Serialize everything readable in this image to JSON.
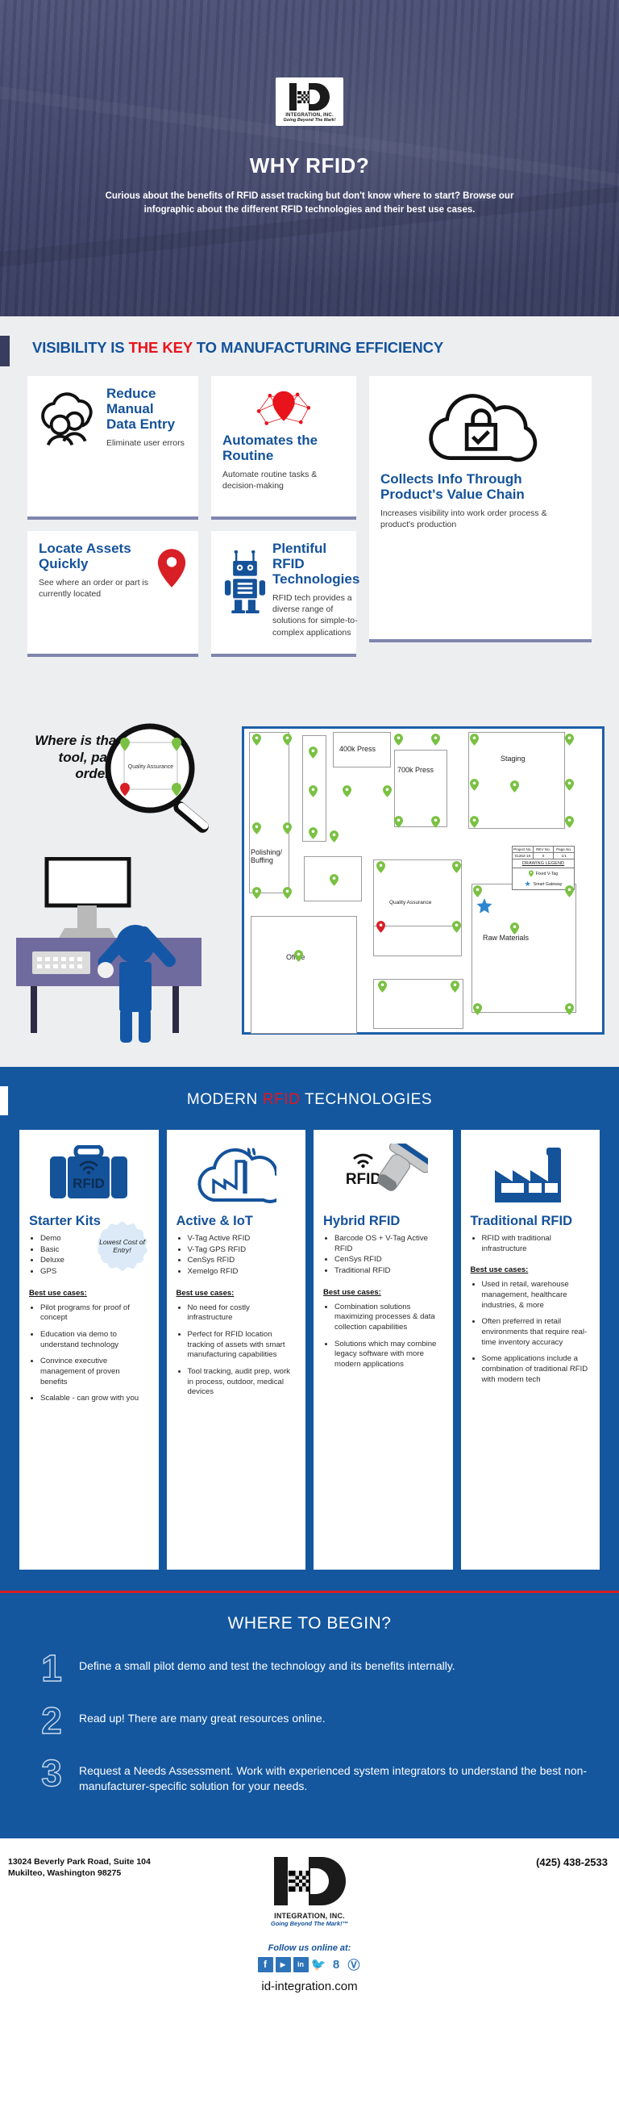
{
  "hero": {
    "logo": {
      "sub": "INTEGRATION, INC.",
      "tagline": "Going Beyond The Mark!"
    },
    "title": "WHY RFID?",
    "subtitle": "Curious about the benefits of RFID asset tracking but don't know where to start? Browse our infographic about the different RFID technologies and their best use cases."
  },
  "section_visibility": {
    "heading_part1": "VISIBILITY IS ",
    "heading_red": "THE KEY",
    "heading_part2": " TO MANUFACTURING EFFICIENCY",
    "cards": [
      {
        "icon": "people-icon",
        "title": "Reduce Manual Data Entry",
        "desc": "Eliminate user errors"
      },
      {
        "icon": "network-node-icon",
        "title": "Automates the Routine",
        "desc": "Automate routine tasks & decision-making"
      },
      {
        "icon": "cloud-lock-icon",
        "title": "Collects Info Through Product's Value Chain",
        "desc": "Increases visibility into work order process & product's production"
      },
      {
        "icon": "map-pin-icon",
        "title": "Locate Assets Quickly",
        "desc": "See where an order or part is currently located"
      },
      {
        "icon": "robot-icon",
        "title": "Plentiful RFID Technologies",
        "desc": "RFID tech provides a diverse range of solutions for simple-to-complex applications"
      }
    ]
  },
  "map_block": {
    "where_text": "Where is that tool, part, order...",
    "magnifier_label": "Quality Assurance",
    "rooms": [
      {
        "label": "400k Press"
      },
      {
        "label": "700k Press"
      },
      {
        "label": "Staging"
      },
      {
        "label": "Polishing/ Buffing"
      },
      {
        "label": "Quality Assurance"
      },
      {
        "label": "Office"
      },
      {
        "label": "Raw Materials"
      }
    ],
    "legend": {
      "headers": [
        "Project No.",
        "REV No.",
        "Page No."
      ],
      "values": [
        "01262-18",
        "0",
        "1/1"
      ],
      "title": "DRAWING LEGEND",
      "keys": [
        {
          "symbol": "pin",
          "label": "Fixed V-Tag"
        },
        {
          "symbol": "star",
          "label": "Smart Gateway"
        }
      ]
    }
  },
  "section_tech": {
    "heading_part1": "MODERN ",
    "heading_red": "RFID",
    "heading_part2": " TECHNOLOGIES",
    "use_cases_label": "Best use cases:",
    "columns": [
      {
        "icon": "rfid-briefcase-icon",
        "icon_text": "RFID",
        "title": "Starter Kits",
        "items": [
          "Demo",
          "Basic",
          "Deluxe",
          "GPS"
        ],
        "badge": "Lowest Cost of Entry!",
        "uses": [
          "Pilot programs for proof of concept",
          "Education via demo to understand technology",
          "Convince executive management of proven benefits",
          "Scalable - can grow with you"
        ]
      },
      {
        "icon": "cloud-factory-icon",
        "title": "Active & IoT",
        "items": [
          "V-Tag Active RFID",
          "V-Tag GPS RFID",
          "CenSys RFID",
          "Xemelgo RFID"
        ],
        "badge": "",
        "uses": [
          "No need for costly infrastructure",
          "Perfect for RFID location tracking of assets with smart manufacturing capabilities",
          "Tool tracking, audit prep, work in process, outdoor, medical devices"
        ]
      },
      {
        "icon": "rfid-scanner-icon",
        "icon_text": "RFID",
        "title": "Hybrid RFID",
        "items": [
          "Barcode OS + V-Tag Active RFID",
          "CenSys RFID",
          "Traditional RFID"
        ],
        "badge": "",
        "uses": [
          "Combination solutions maximizing processes & data collection capabilities",
          "Solutions which may combine legacy software with more modern applications"
        ]
      },
      {
        "icon": "factory-icon",
        "title": "Traditional RFID",
        "items": [
          "RFID with traditional infrastructure"
        ],
        "badge": "",
        "uses": [
          "Used in retail, warehouse management, healthcare industries, & more",
          "Often preferred in retail environments that require real-time inventory accuracy",
          "Some applications include a combination of traditional RFID with modern tech"
        ]
      }
    ]
  },
  "section_begin": {
    "heading": "WHERE TO BEGIN?",
    "steps": [
      {
        "num": "1",
        "text": "Define a small pilot demo and test the technology and its benefits internally."
      },
      {
        "num": "2",
        "text": "Read up! There are many great resources online."
      },
      {
        "num": "3",
        "text": "Request a Needs Assessment. Work with experienced system integrators to understand the best non-manufacturer-specific solution for your needs."
      }
    ]
  },
  "footer": {
    "address_line1": "13024 Beverly Park Road, Suite 104",
    "address_line2": "Mukilteo, Washington 98275",
    "phone": "(425) 438-2533",
    "logo": {
      "sub": "INTEGRATION, INC.",
      "tagline": "Going Beyond The Mark!™"
    },
    "follow_label": "Follow us online at:",
    "socials": [
      "facebook",
      "youtube",
      "linkedin",
      "twitter",
      "googleplus",
      "pinterest"
    ],
    "url": "id-integration.com"
  },
  "colors": {
    "brand_blue": "#14529a",
    "band_blue": "#14579f",
    "accent_red": "#e8131b",
    "grey_bg": "#eceef0",
    "pin_green": "#7ac143",
    "pin_red": "#d81f26"
  }
}
